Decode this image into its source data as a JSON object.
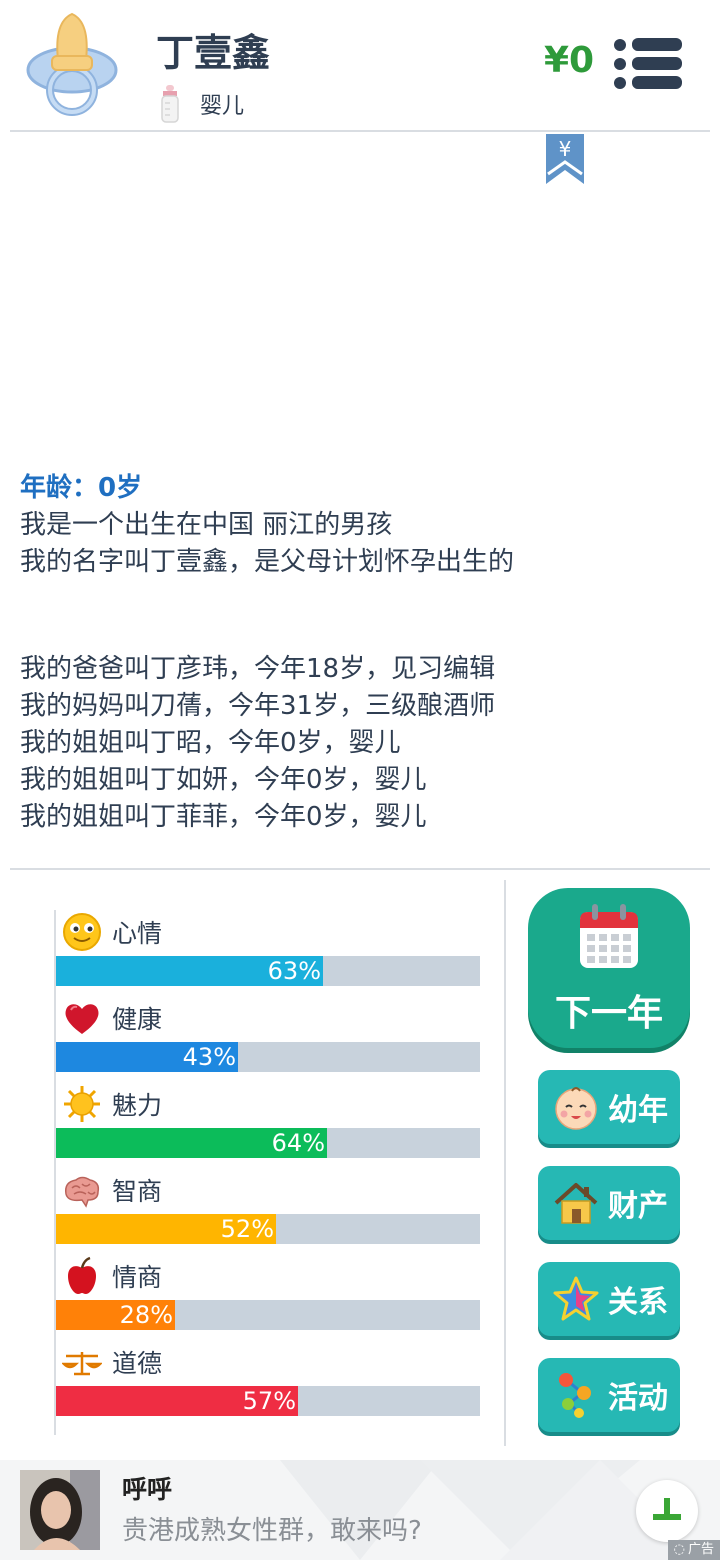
{
  "header": {
    "name": "丁壹鑫",
    "stage": "婴儿",
    "money": "¥0",
    "bookmark_symbol": "¥"
  },
  "story": {
    "age_line": "年龄：0岁",
    "intro": [
      "我是一个出生在中国 丽江的男孩",
      "我的名字叫丁壹鑫，是父母计划怀孕出生的"
    ],
    "family": [
      "我的爸爸叫丁彦玮，今年18岁，见习编辑",
      "我的妈妈叫刀蒨，今年31岁，三级酿酒师",
      "我的姐姐叫丁昭，今年0岁，婴儿",
      "我的姐姐叫丁如妍，今年0岁，婴儿",
      "我的姐姐叫丁菲菲，今年0岁，婴儿"
    ]
  },
  "stats": [
    {
      "label": "心情",
      "value": 63,
      "text": "63%",
      "color": "#1ab0dc",
      "icon": "smiley-icon"
    },
    {
      "label": "健康",
      "value": 43,
      "text": "43%",
      "color": "#1e88e0",
      "icon": "heart-icon"
    },
    {
      "label": "魅力",
      "value": 64,
      "text": "64%",
      "color": "#0cbc5a",
      "icon": "sun-icon"
    },
    {
      "label": "智商",
      "value": 52,
      "text": "52%",
      "color": "#ffb500",
      "icon": "brain-icon"
    },
    {
      "label": "情商",
      "value": 28,
      "text": "28%",
      "color": "#ff8108",
      "icon": "apple-icon"
    },
    {
      "label": "道德",
      "value": 57,
      "text": "57%",
      "color": "#ef2d43",
      "icon": "scales-icon"
    }
  ],
  "actions": {
    "next_year": "下一年",
    "childhood": "幼年",
    "assets": "财产",
    "relations": "关系",
    "activities": "活动"
  },
  "ad": {
    "title": "呼呼",
    "desc": "贵港成熟女性群，敢来吗?",
    "tag": "广告"
  },
  "colors": {
    "money": "#2e9a3a",
    "age": "#1f6fc1",
    "next_year_bg": "#1aa98c",
    "side_button_bg": "#26b8b4"
  }
}
